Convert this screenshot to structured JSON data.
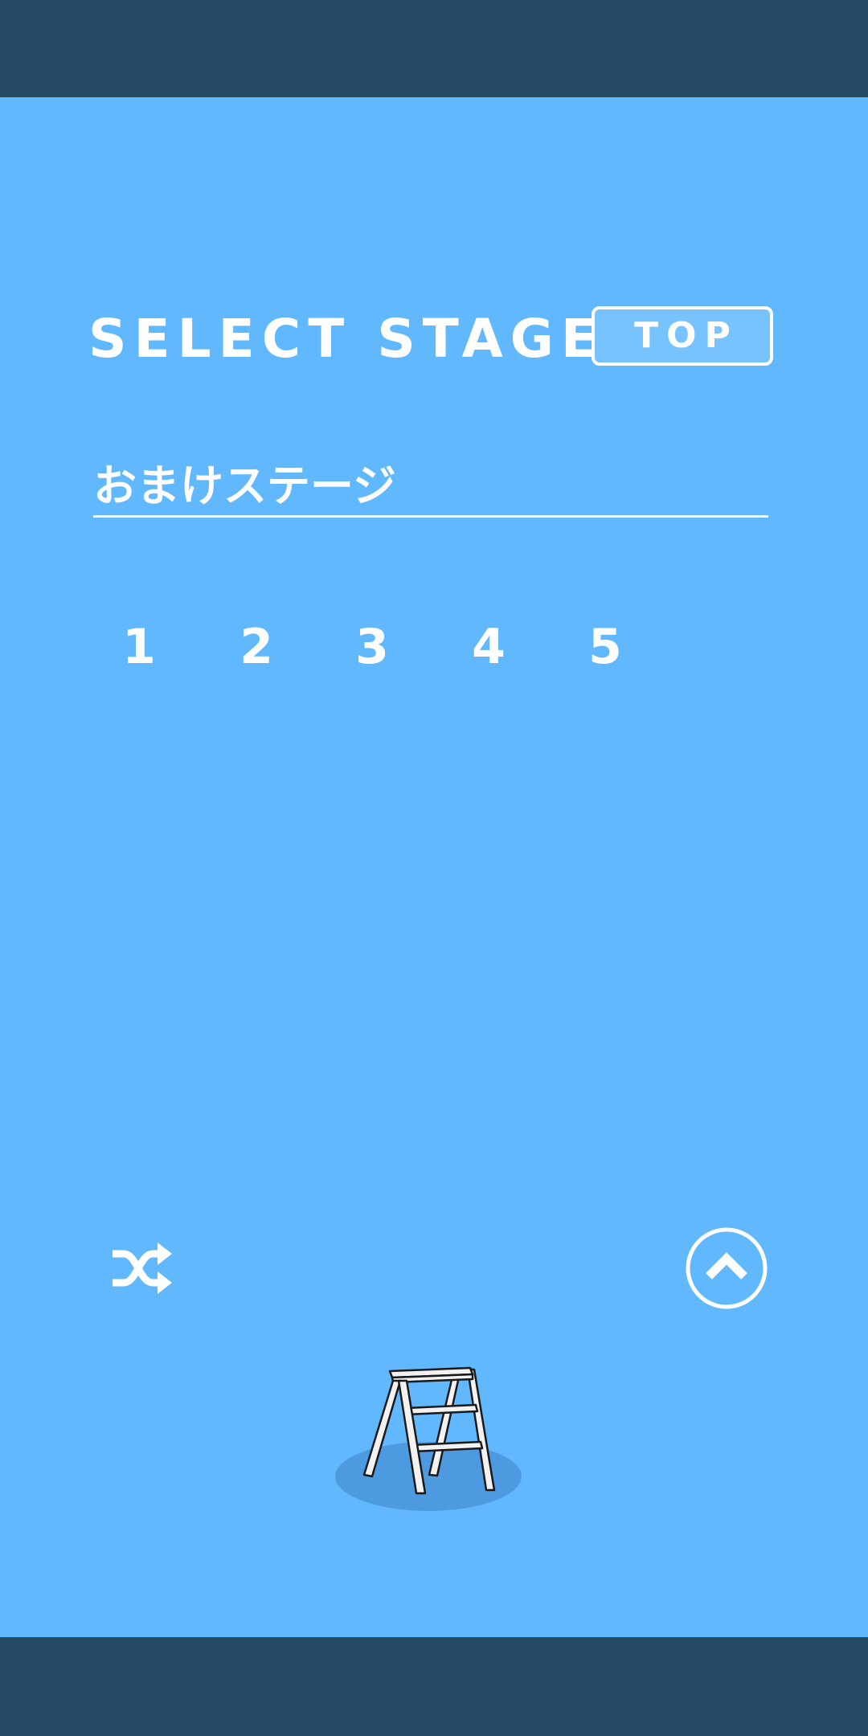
{
  "header": {
    "title": "SELECT STAGE",
    "top_button_label": "TOP"
  },
  "section": {
    "heading": "おまけステージ"
  },
  "stages": [
    "1",
    "2",
    "3",
    "4",
    "5"
  ],
  "icons": {
    "shuffle": "shuffle-icon",
    "scroll_up": "chevron-up-icon",
    "ladder": "stepladder-icon"
  },
  "colors": {
    "background": "#61b8fd",
    "bars": "#254a66",
    "text": "#ffffff",
    "shadow": "#4d9ae0"
  }
}
